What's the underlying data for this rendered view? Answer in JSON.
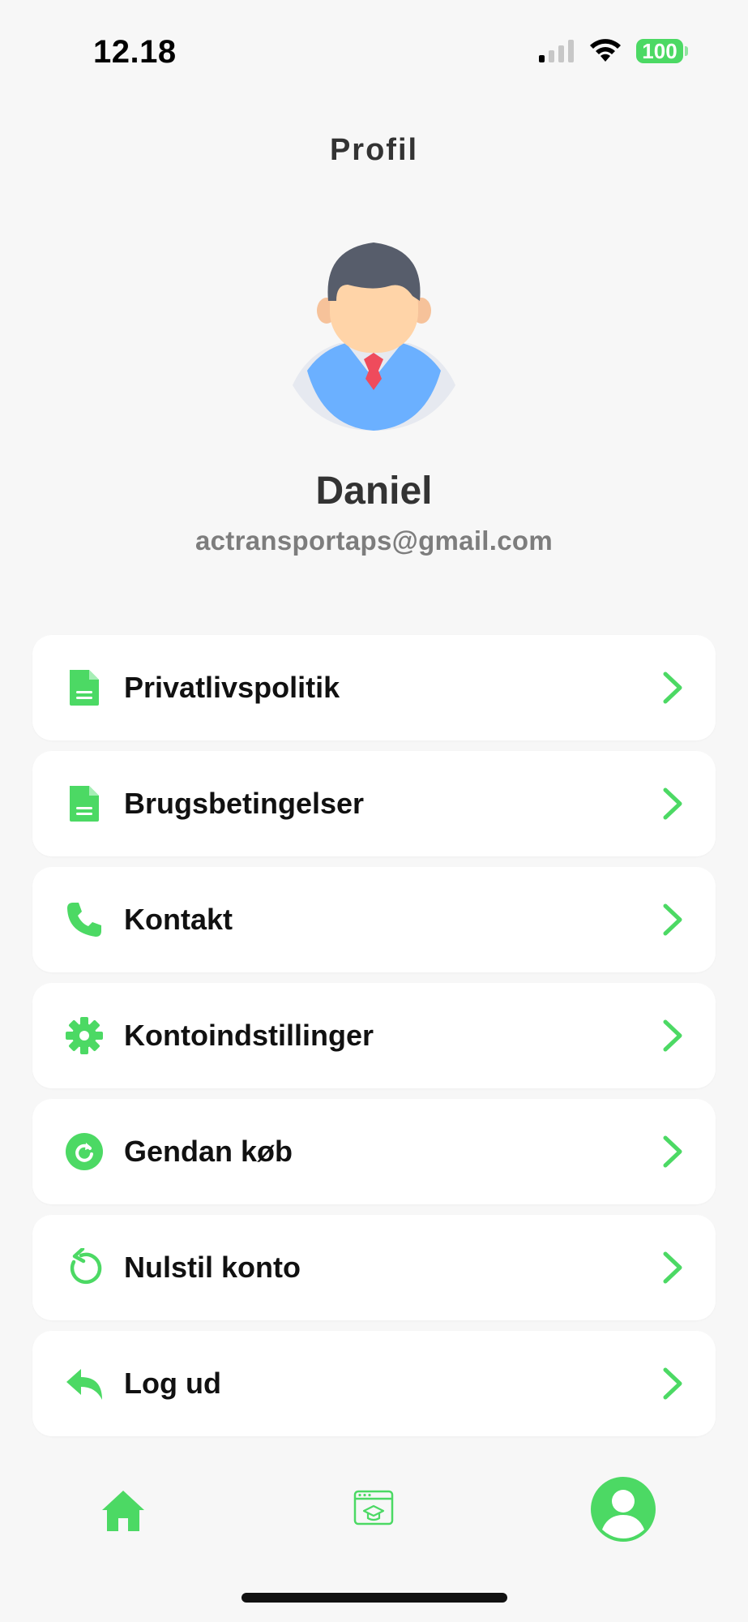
{
  "status_bar": {
    "time": "12.18",
    "battery": "100"
  },
  "page": {
    "title": "Profil"
  },
  "user": {
    "name": "Daniel",
    "email": "actransportaps@gmail.com"
  },
  "menu": {
    "items": [
      {
        "label": "Privatlivspolitik",
        "icon": "document-icon"
      },
      {
        "label": "Brugsbetingelser",
        "icon": "document-icon"
      },
      {
        "label": "Kontakt",
        "icon": "phone-icon"
      },
      {
        "label": "Kontoindstillinger",
        "icon": "gear-icon"
      },
      {
        "label": "Gendan køb",
        "icon": "restore-icon"
      },
      {
        "label": "Nulstil konto",
        "icon": "reset-icon"
      },
      {
        "label": "Log ud",
        "icon": "logout-icon"
      }
    ]
  },
  "tab_bar": {
    "tabs": [
      "home-icon",
      "course-icon",
      "profile-icon"
    ],
    "active": "profile-icon"
  },
  "colors": {
    "accent": "#4cd964",
    "background": "#f7f7f7",
    "card": "#ffffff",
    "text": "#111111",
    "muted": "#7d7d7d"
  }
}
